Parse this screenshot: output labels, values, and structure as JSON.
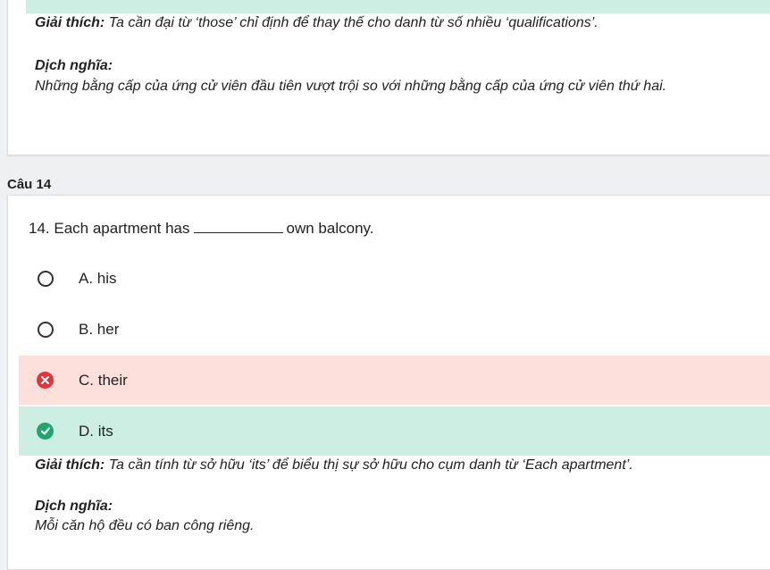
{
  "previous": {
    "explain_label": "Giải thích:",
    "explain_text": "Ta cần đại từ ‘those’ chỉ định để thay thế cho danh từ số nhiều ‘qualifications’.",
    "translate_label": "Dịch nghĩa:",
    "translate_text": "Những bằng cấp của ứng cử viên đầu tiên vượt trội so với những bằng cấp của ứng cử viên thứ hai."
  },
  "question": {
    "heading": "Câu 14",
    "text_before": "14. Each apartment has",
    "text_after": "own balcony.",
    "options": [
      {
        "label": "A. his",
        "state": "unselected"
      },
      {
        "label": "B. her",
        "state": "unselected"
      },
      {
        "label": "C. their",
        "state": "wrong"
      },
      {
        "label": "D. its",
        "state": "correct"
      }
    ],
    "explain_label": "Giải thích:",
    "explain_text": "Ta cần tính từ sở hữu ‘its’ để biểu thị sự sở hữu cho cụm danh từ ‘Each apartment’.",
    "translate_label": "Dịch nghĩa:",
    "translate_text": "Mỗi căn hộ đều có ban công riêng."
  },
  "colors": {
    "correct_bg": "#cdeee3",
    "wrong_bg": "#fde0dc",
    "wrong_icon": "#e2343a",
    "correct_icon": "#21a46f"
  }
}
